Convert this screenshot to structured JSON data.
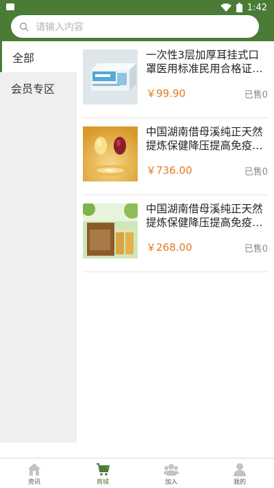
{
  "status": {
    "time": "1:42"
  },
  "search": {
    "placeholder": "请输入内容"
  },
  "categories": [
    {
      "label": "全部",
      "active": true
    },
    {
      "label": "会员专区",
      "active": false
    }
  ],
  "products": [
    {
      "title": "一次性3层加厚耳挂式口罩医用标准民用合格证…",
      "price": "￥99.90",
      "sold": "已售0"
    },
    {
      "title": "中国湖南借母溪纯正天然提炼保健降压提高免疫…",
      "price": "￥736.00",
      "sold": "已售0"
    },
    {
      "title": "中国湖南借母溪纯正天然提炼保健降压提高免疫…",
      "price": "￥268.00",
      "sold": "已售0"
    }
  ],
  "bottom_nav": [
    {
      "label": "资讯",
      "icon": "home-icon"
    },
    {
      "label": "商城",
      "icon": "cart-icon",
      "active": true
    },
    {
      "label": "加入",
      "icon": "group-icon"
    },
    {
      "label": "我的",
      "icon": "user-icon"
    }
  ],
  "colors": {
    "primary": "#4a7c36",
    "price": "#e07a1f"
  }
}
